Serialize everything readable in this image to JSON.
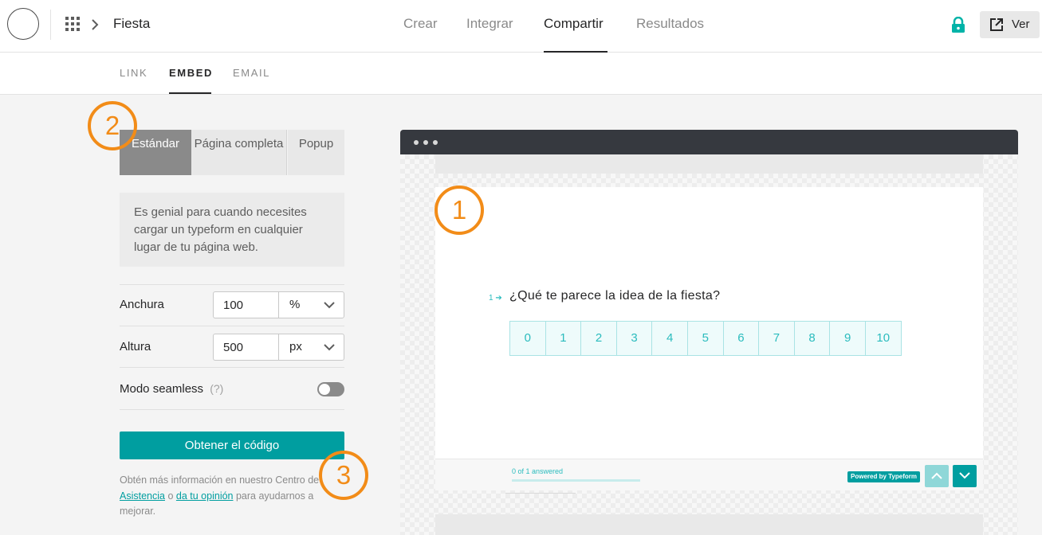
{
  "header": {
    "workspace_title": "Fiesta",
    "nav": [
      {
        "label": "Crear"
      },
      {
        "label": "Integrar"
      },
      {
        "label": "Compartir",
        "active": true
      },
      {
        "label": "Resultados"
      }
    ],
    "view_button_label": "Ver"
  },
  "share_tabs": [
    {
      "label": "LINK"
    },
    {
      "label": "EMBED",
      "active": true
    },
    {
      "label": "EMAIL"
    }
  ],
  "embed_panel": {
    "modes": [
      {
        "label": "Estándar",
        "selected": true
      },
      {
        "label": "Página completa"
      },
      {
        "label": "Popup"
      }
    ],
    "description": "Es genial para cuando necesites cargar un typeform en cualquier lugar de tu página web.",
    "width": {
      "label": "Anchura",
      "value": "100",
      "unit": "%"
    },
    "height": {
      "label": "Altura",
      "value": "500",
      "unit": "px"
    },
    "seamless": {
      "label": "Modo seamless",
      "help": "(?)",
      "enabled": false
    },
    "get_code_label": "Obtener el código",
    "help_text_prefix": "Obtén más información en nuestro Centro de",
    "help_link_1": "Asistencia",
    "help_text_mid": "o",
    "help_link_2": "da tu opinión",
    "help_text_suffix": "para ayudarnos a mejorar."
  },
  "annotations": [
    "1",
    "2",
    "3"
  ],
  "preview": {
    "question_number": "1",
    "question_text": "¿Qué te parece la idea de la fiesta?",
    "scale": [
      "0",
      "1",
      "2",
      "3",
      "4",
      "5",
      "6",
      "7",
      "8",
      "9",
      "10"
    ],
    "progress_text": "0 of 1 answered",
    "progress_fraction": 0,
    "powered_by": "Powered by Typeform"
  },
  "colors": {
    "accent": "#009ea0",
    "accent_light": "#2bbcbe",
    "annotation": "#f28c18",
    "browser_bar": "#36393f"
  }
}
